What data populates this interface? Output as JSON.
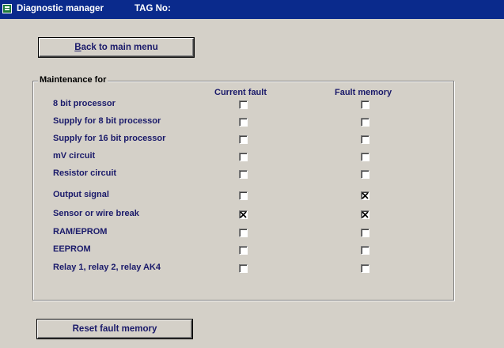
{
  "window": {
    "title": "Diagnostic manager",
    "tag_label": "TAG No:"
  },
  "buttons": {
    "back": "Back to main menu",
    "reset": "Reset fault memory"
  },
  "maintenance": {
    "group_label": "Maintenance for",
    "columns": {
      "current": "Current fault",
      "memory": "Fault memory"
    },
    "rows": [
      {
        "label": "8 bit processor",
        "current_fault": false,
        "fault_memory": false
      },
      {
        "label": "Supply for 8 bit processor",
        "current_fault": false,
        "fault_memory": false
      },
      {
        "label": "Supply for 16 bit processor",
        "current_fault": false,
        "fault_memory": false
      },
      {
        "label": "mV circuit",
        "current_fault": false,
        "fault_memory": false
      },
      {
        "label": "Resistor circuit",
        "current_fault": false,
        "fault_memory": false
      },
      {
        "label": "Output signal",
        "current_fault": false,
        "fault_memory": true
      },
      {
        "label": "Sensor or wire break",
        "current_fault": true,
        "fault_memory": true
      },
      {
        "label": "RAM/EPROM",
        "current_fault": false,
        "fault_memory": false
      },
      {
        "label": "EEPROM",
        "current_fault": false,
        "fault_memory": false
      },
      {
        "label": "Relay 1, relay 2, relay AK4",
        "current_fault": false,
        "fault_memory": false
      }
    ]
  },
  "colors": {
    "titlebar": "#0a2a8c",
    "label_text": "#1a1a6a",
    "face": "#d4d0c8"
  }
}
